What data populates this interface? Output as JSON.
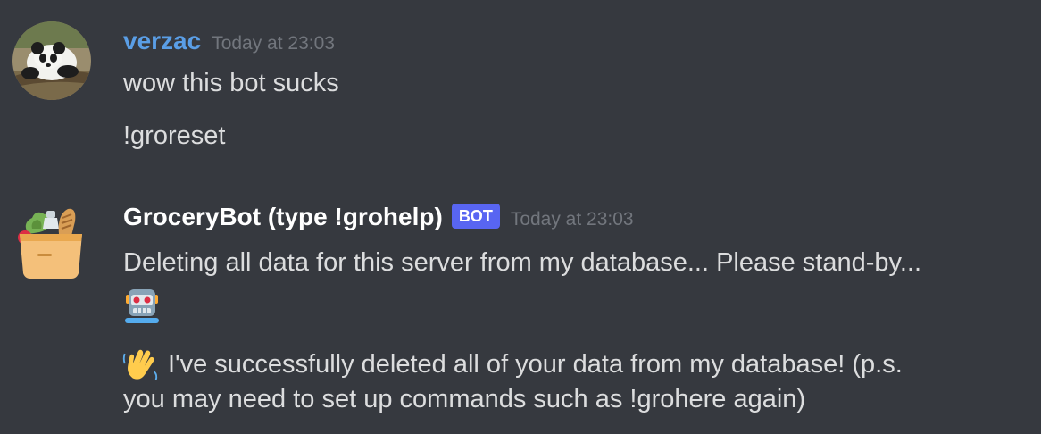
{
  "messages": [
    {
      "author": "verzac",
      "author_color": "#5a9ee6",
      "timestamp": "Today at 23:03",
      "avatar_icon": "panda-avatar-icon",
      "lines": [
        "wow this bot sucks",
        "!groreset"
      ]
    },
    {
      "author": "GroceryBot (type !grohelp)",
      "author_color": "#ffffff",
      "badge": "BOT",
      "badge_color": "#5865f2",
      "timestamp": "Today at 23:03",
      "avatar_icon": "grocery-bag-icon",
      "lines": [
        "Deleting all data for this server from my database... Please stand-by...",
        "robot-emoji",
        "I've successfully deleted all of your data from my database! (p.s.",
        "you may need to set up commands such as !grohere again)"
      ],
      "emojis": [
        "robot-icon",
        "waving-hand-icon"
      ]
    }
  ]
}
